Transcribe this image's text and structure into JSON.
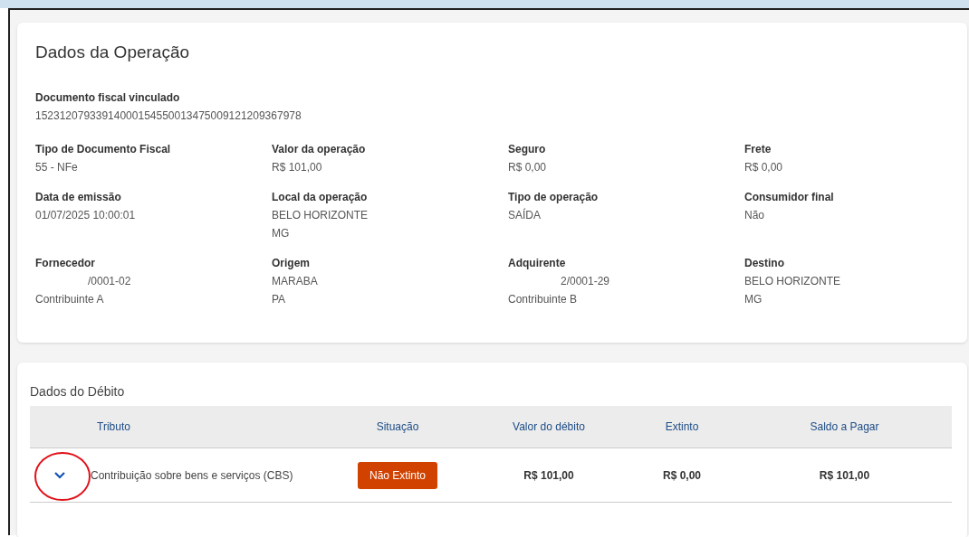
{
  "operation": {
    "title": "Dados da Operação",
    "document": {
      "label": "Documento fiscal vinculado",
      "values": [
        "15231207933914000154550013475009121209367978"
      ]
    },
    "fields": [
      {
        "label": "Tipo de Documento Fiscal",
        "values": [
          "55 - NFe"
        ],
        "redacted": false
      },
      {
        "label": "Valor da operação",
        "values": [
          "R$ 101,00"
        ],
        "redacted": false
      },
      {
        "label": "Seguro",
        "values": [
          "R$ 0,00"
        ],
        "redacted": false
      },
      {
        "label": "Frete",
        "values": [
          "R$ 0,00"
        ],
        "redacted": false
      },
      {
        "label": "Data de emissão",
        "values": [
          "01/07/2025 10:00:01"
        ],
        "redacted": false
      },
      {
        "label": "Local da operação",
        "values": [
          "BELO HORIZONTE",
          "MG"
        ],
        "redacted": false
      },
      {
        "label": "Tipo de operação",
        "values": [
          "SAÍDA"
        ],
        "redacted": false
      },
      {
        "label": "Consumidor final",
        "values": [
          "Não"
        ],
        "redacted": false
      },
      {
        "label": "Fornecedor",
        "values": [
          "/0001-02",
          "Contribuinte A"
        ],
        "redacted": true
      },
      {
        "label": "Origem",
        "values": [
          "MARABA",
          "PA"
        ],
        "redacted": false
      },
      {
        "label": "Adquirente",
        "values": [
          "2/0001-29",
          "Contribuinte B"
        ],
        "redacted": true
      },
      {
        "label": "Destino",
        "values": [
          "BELO HORIZONTE",
          "MG"
        ],
        "redacted": false
      }
    ]
  },
  "debit": {
    "title": "Dados do Débito",
    "table": {
      "columns": [
        "Tributo",
        "Situação",
        "Valor do débito",
        "Extinto",
        "Saldo a Pagar"
      ],
      "rows": [
        {
          "expanded": false,
          "annotated": true,
          "tributo": "Contribuição sobre bens e serviços (CBS)",
          "status": {
            "label": "Não Extinto",
            "kind": "open"
          },
          "valor": "R$ 101,00",
          "extinto": "R$ 0,00",
          "saldo": "R$ 101,00"
        }
      ]
    }
  }
}
